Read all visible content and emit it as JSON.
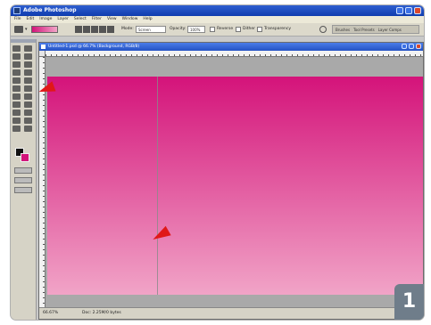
{
  "app": {
    "title": "Adobe Photoshop"
  },
  "menus": [
    "File",
    "Edit",
    "Image",
    "Layer",
    "Select",
    "Filter",
    "View",
    "Window",
    "Help"
  ],
  "options_bar": {
    "mode_label": "Mode:",
    "mode_value": "Screen",
    "opacity_label": "Opacity:",
    "opacity_value": "100%",
    "reverse_label": "Reverse",
    "dither_label": "Dither",
    "transparency_label": "Transparency",
    "palette_tabs": [
      "Brushes",
      "Tool Presets",
      "Layer Comps"
    ]
  },
  "document": {
    "title": "Untitled-1.psd @ 66.7% (Background, RGB/8)",
    "gradient_start": "#d4137a",
    "gradient_end": "#f1a4c7"
  },
  "status": {
    "zoom": "66.67%",
    "doc_info": "Doc: 2.25M/0 bytes"
  },
  "annotations": {
    "step_number": "1",
    "arrow_color": "#e01818"
  }
}
